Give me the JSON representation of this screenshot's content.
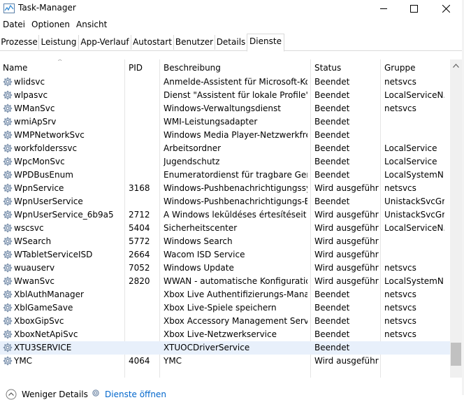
{
  "window": {
    "title": "Task-Manager",
    "minimize_glyph": "—",
    "maximize_glyph": "☐",
    "close_glyph": "✕"
  },
  "menu": [
    "Datei",
    "Optionen",
    "Ansicht"
  ],
  "tabs": [
    "Prozesse",
    "Leistung",
    "App-Verlauf",
    "Autostart",
    "Benutzer",
    "Details",
    "Dienste"
  ],
  "active_tab": "Dienste",
  "columns": {
    "name": "Name",
    "pid": "PID",
    "description": "Beschreibung",
    "status": "Status",
    "group": "Gruppe"
  },
  "sort_indicator": "^",
  "rows": [
    {
      "name": "wlidsvc",
      "pid": "",
      "description": "Anmelde-Assistent für Microsoft-Ko...",
      "status": "Beendet",
      "group": "netsvcs"
    },
    {
      "name": "wlpasvc",
      "pid": "",
      "description": "Dienst \"Assistent für lokale Profile\"",
      "status": "Beendet",
      "group": "LocalServiceN..."
    },
    {
      "name": "WManSvc",
      "pid": "",
      "description": "Windows-Verwaltungsdienst",
      "status": "Beendet",
      "group": "netsvcs"
    },
    {
      "name": "wmiApSrv",
      "pid": "",
      "description": "WMI-Leistungsadapter",
      "status": "Beendet",
      "group": ""
    },
    {
      "name": "WMPNetworkSvc",
      "pid": "",
      "description": "Windows Media Player-Netzwerkfrei...",
      "status": "Beendet",
      "group": ""
    },
    {
      "name": "workfolderssvc",
      "pid": "",
      "description": "Arbeitsordner",
      "status": "Beendet",
      "group": "LocalService"
    },
    {
      "name": "WpcMonSvc",
      "pid": "",
      "description": "Jugendschutz",
      "status": "Beendet",
      "group": "LocalService"
    },
    {
      "name": "WPDBusEnum",
      "pid": "",
      "description": "Enumeratordienst für tragbare Geräte",
      "status": "Beendet",
      "group": "LocalSystemN..."
    },
    {
      "name": "WpnService",
      "pid": "3168",
      "description": "Windows-Pushbenachrichtigungssy...",
      "status": "Wird ausgeführt",
      "group": "netsvcs"
    },
    {
      "name": "WpnUserService",
      "pid": "",
      "description": "Windows-Pushbenachrichtigungs-B...",
      "status": "Beendet",
      "group": "UnistackSvcGr..."
    },
    {
      "name": "WpnUserService_6b9a5",
      "pid": "2712",
      "description": "A Windows lekūldéses értesítéseit ke...",
      "status": "Wird ausgeführt",
      "group": "UnistackSvcGr..."
    },
    {
      "name": "wscsvc",
      "pid": "5404",
      "description": "Sicherheitscenter",
      "status": "Wird ausgeführt",
      "group": "LocalServiceN..."
    },
    {
      "name": "WSearch",
      "pid": "5772",
      "description": "Windows Search",
      "status": "Wird ausgeführt",
      "group": ""
    },
    {
      "name": "WTabletServiceISD",
      "pid": "2664",
      "description": "Wacom ISD Service",
      "status": "Wird ausgeführt",
      "group": ""
    },
    {
      "name": "wuauserv",
      "pid": "7052",
      "description": "Windows Update",
      "status": "Wird ausgeführt",
      "group": "netsvcs"
    },
    {
      "name": "WwanSvc",
      "pid": "2820",
      "description": "WWAN - automatische Konfiguration",
      "status": "Wird ausgeführt",
      "group": "LocalSystemN..."
    },
    {
      "name": "XblAuthManager",
      "pid": "",
      "description": "Xbox Live Authentifizierungs-Manag...",
      "status": "Beendet",
      "group": "netsvcs"
    },
    {
      "name": "XblGameSave",
      "pid": "",
      "description": "Xbox Live-Spiele speichern",
      "status": "Beendet",
      "group": "netsvcs"
    },
    {
      "name": "XboxGipSvc",
      "pid": "",
      "description": "Xbox Accessory Management Service",
      "status": "Beendet",
      "group": "netsvcs"
    },
    {
      "name": "XboxNetApiSvc",
      "pid": "",
      "description": "Xbox Live-Netzwerkservice",
      "status": "Beendet",
      "group": "netsvcs"
    },
    {
      "name": "XTU3SERVICE",
      "pid": "",
      "description": "XTUOCDriverService",
      "status": "Beendet",
      "group": ""
    },
    {
      "name": "YMC",
      "pid": "4064",
      "description": "YMC",
      "status": "Wird ausgeführt",
      "group": ""
    }
  ],
  "selected_row": "XTU3SERVICE",
  "footer": {
    "fewer_details": "Weniger Details",
    "open_services": "Dienste öffnen"
  },
  "colors": {
    "selection": "#e8f0fb",
    "link": "#0066cc",
    "gear": "#7a8ea8"
  }
}
